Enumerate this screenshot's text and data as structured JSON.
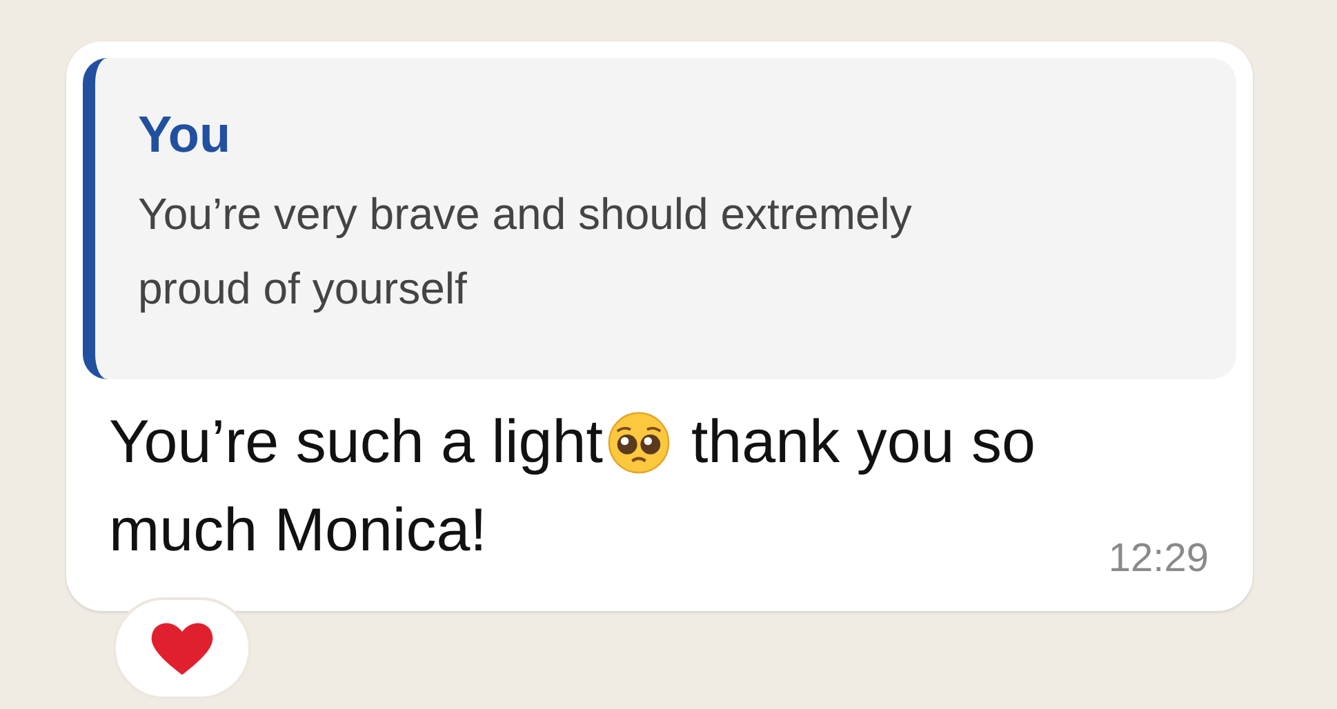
{
  "message": {
    "quote": {
      "author": "You",
      "text": "You’re very brave and should extremely proud of yourself"
    },
    "lines": [
      {
        "text_before": "You’re such a light",
        "text_after": "thank you so"
      },
      {
        "text_before": "much Monica!"
      }
    ],
    "time": "12:29"
  },
  "reactions": [
    {
      "kind": "heart"
    }
  ]
}
